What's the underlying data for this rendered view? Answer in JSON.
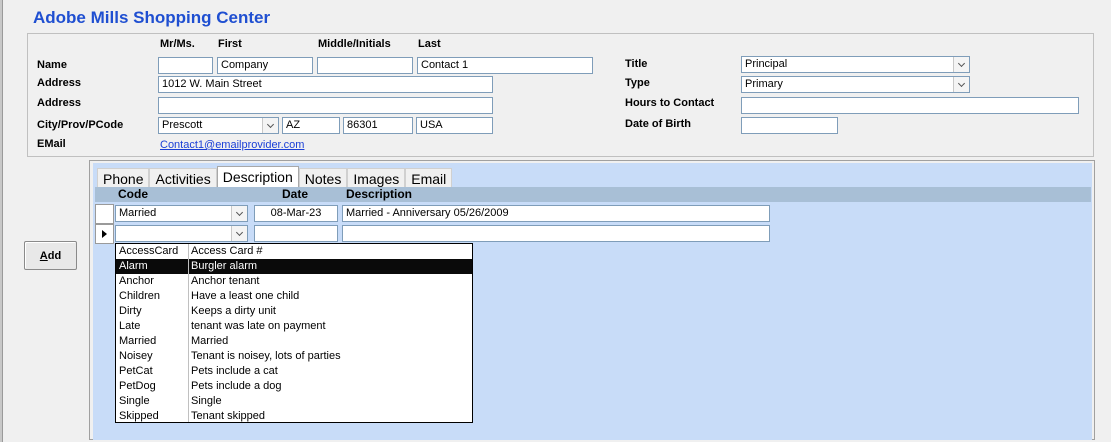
{
  "app": {
    "title": "Adobe Mills Shopping Center"
  },
  "contact": {
    "col_headers": {
      "mr_ms": "Mr/Ms.",
      "first": "First",
      "middle": "Middle/Initials",
      "last": "Last"
    },
    "labels": {
      "name": "Name",
      "address1": "Address",
      "address2": "Address",
      "city_prov_pcode": "City/Prov/PCode",
      "email": "EMail",
      "title": "Title",
      "type": "Type",
      "hours_to_contact": "Hours to Contact",
      "date_of_birth": "Date of Birth"
    },
    "values": {
      "mr_ms": "",
      "first": "Company",
      "middle": "",
      "last": "Contact 1",
      "address1": "1012 W. Main Street",
      "address2": "",
      "city": "Prescott",
      "prov": "AZ",
      "pcode": "86301",
      "country": "USA",
      "email": "Contact1@emailprovider.com",
      "title": "Principal",
      "type": "Primary",
      "hours_to_contact": "",
      "date_of_birth": ""
    }
  },
  "buttons": {
    "add_prefix": "A",
    "add_rest": "dd"
  },
  "tabs": [
    "Phone",
    "Activities",
    "Description",
    "Notes",
    "Images",
    "Email"
  ],
  "active_tab": "Description",
  "grid": {
    "headers": {
      "code": "Code",
      "date": "Date",
      "description": "Description"
    },
    "rows": [
      {
        "code": "Married",
        "date": "08-Mar-23",
        "description": "Married - Anniversary 05/26/2009"
      },
      {
        "code": "",
        "date": "",
        "description": ""
      }
    ]
  },
  "dropdown_options": [
    {
      "code": "AccessCard",
      "desc": "Access Card #"
    },
    {
      "code": "Alarm",
      "desc": "Burgler alarm"
    },
    {
      "code": "Anchor",
      "desc": "Anchor tenant"
    },
    {
      "code": "Children",
      "desc": "Have a least one child"
    },
    {
      "code": "Dirty",
      "desc": "Keeps a dirty unit"
    },
    {
      "code": "Late",
      "desc": "tenant was late on payment"
    },
    {
      "code": "Married",
      "desc": "Married"
    },
    {
      "code": "Noisey",
      "desc": "Tenant is noisey, lots of parties"
    },
    {
      "code": "PetCat",
      "desc": "Pets include a cat"
    },
    {
      "code": "PetDog",
      "desc": "Pets include a dog"
    },
    {
      "code": "Single",
      "desc": "Single"
    },
    {
      "code": "Skipped",
      "desc": "Tenant skipped"
    }
  ],
  "dropdown_selected": "Alarm",
  "colors": {
    "title": "#1f4fd1",
    "panel_blue": "#c8dcf8",
    "grid_header": "#a8bfd6",
    "link": "#1a3fd6"
  }
}
